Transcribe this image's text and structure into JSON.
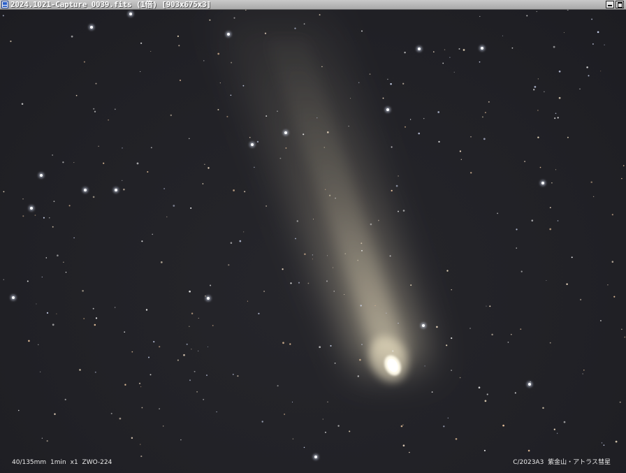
{
  "window": {
    "title": "2024.1021-Capture_0039.fits (1倍) [903x675x3]"
  },
  "image": {
    "caption_left": "40/135mm 1min x1 ZWO-224",
    "caption_right": "C/2023A3 紫金山・アトラス彗星"
  }
}
